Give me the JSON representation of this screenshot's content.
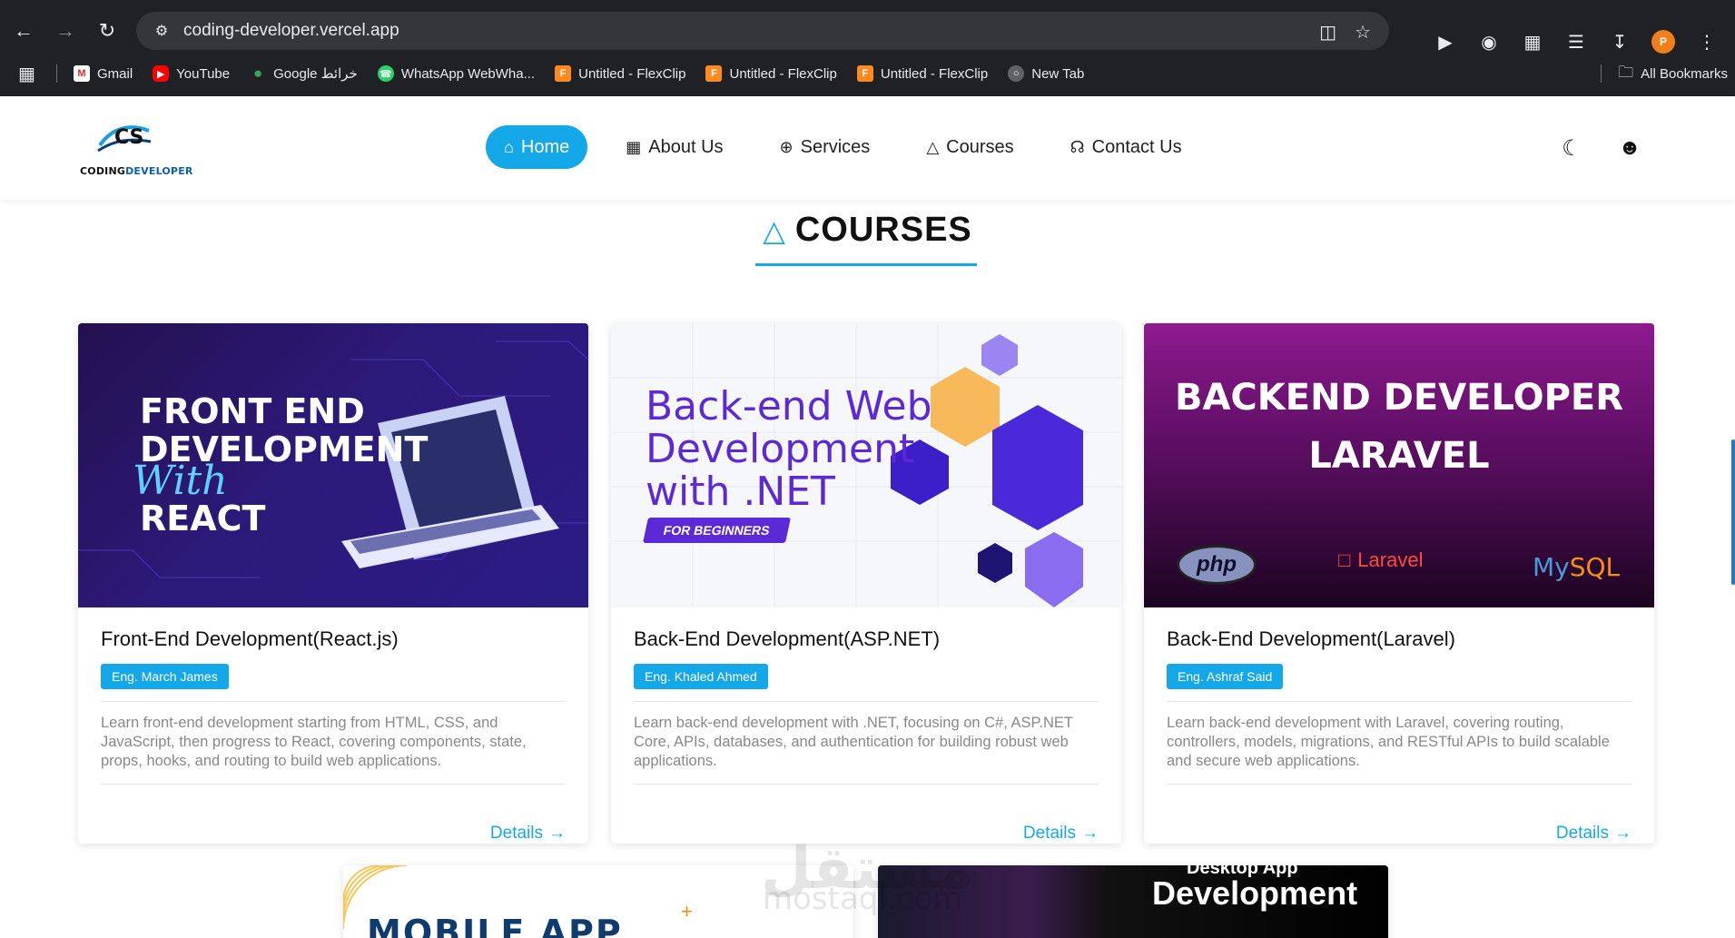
{
  "browser": {
    "url": "coding-developer.vercel.app",
    "bookmarks": [
      {
        "label": "Gmail"
      },
      {
        "label": "YouTube"
      },
      {
        "label": "Google خرائط"
      },
      {
        "label": "WhatsApp WebWha..."
      },
      {
        "label": "Untitled - FlexClip"
      },
      {
        "label": "Untitled - FlexClip"
      },
      {
        "label": "Untitled - FlexClip"
      },
      {
        "label": "New Tab"
      }
    ],
    "all_bookmarks": "All Bookmarks",
    "avatar_letter": "P"
  },
  "site": {
    "logo": {
      "mark": "CS",
      "word1": "CODING",
      "word2": "DEVELOPER"
    },
    "nav": [
      {
        "label": "Home",
        "active": true
      },
      {
        "label": "About Us"
      },
      {
        "label": "Services"
      },
      {
        "label": "Courses"
      },
      {
        "label": "Contact Us"
      }
    ]
  },
  "section": {
    "title": "COURSES"
  },
  "cards": [
    {
      "banner_lines": [
        "FRONT END",
        "DEVELOPMENT"
      ],
      "banner_with": "With",
      "banner_last": "REACT",
      "title": "Front-End Development(React.js)",
      "instructor": "Eng. March James",
      "description": "Learn front-end development starting from HTML, CSS, and JavaScript, then progress to React, covering components, state, props, hooks, and routing to build web applications.",
      "details": "Details"
    },
    {
      "banner_lines": [
        "Back-end Web",
        "Development",
        "with .NET"
      ],
      "banner_pill": "FOR BEGINNERS",
      "title": "Back-End Development(ASP.NET)",
      "instructor": "Eng. Khaled Ahmed",
      "description": "Learn back-end development with .NET, focusing on C#, ASP.NET Core, APIs, databases, and authentication for building robust web applications.",
      "details": "Details"
    },
    {
      "banner_lines": [
        "BACKEND DEVELOPER",
        "LARAVEL"
      ],
      "logos": {
        "php": "php",
        "laravel": "Laravel",
        "mysql_a": "My",
        "mysql_b": "SQL"
      },
      "title": "Back-End Development(Laravel)",
      "instructor": "Eng. Ashraf Said",
      "description": "Learn back-end development with Laravel, covering routing, controllers, models, migrations, and RESTful APIs to build scalable and secure web applications.",
      "details": "Details"
    }
  ],
  "row2": {
    "mobile_title": "MOBILE APP",
    "desktop_sub": "Desktop App",
    "desktop_title": "Development"
  },
  "watermark": {
    "arabic": "مستقل",
    "latin": "mostaql.com"
  },
  "colors": {
    "accent": "#14a8e8",
    "chrome": "#202124"
  }
}
